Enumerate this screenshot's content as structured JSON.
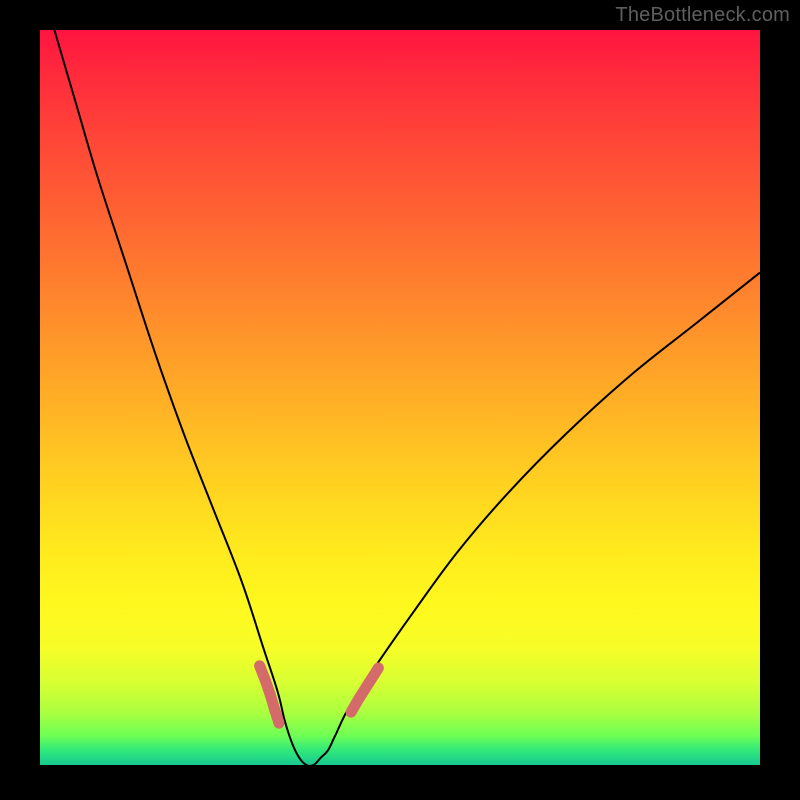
{
  "watermark": "TheBottleneck.com",
  "palette": {
    "gradient_top": "#ff1440",
    "gradient_mid": "#ffe81e",
    "gradient_bottom": "#18c990",
    "curve_stroke": "#000000",
    "marker_fill": "#d46a6a",
    "background": "#000000"
  },
  "chart_data": {
    "type": "line",
    "title": "",
    "xlabel": "",
    "ylabel": "",
    "xlim": [
      0,
      100
    ],
    "ylim": [
      0,
      100
    ],
    "grid": false,
    "legend": false,
    "notes": "V-shaped bottleneck curve; y represents bottleneck severity (0 = balanced/green, 100 = max/red). Minimum is around x≈37.",
    "x": [
      2,
      5,
      8,
      12,
      16,
      20,
      24,
      28,
      31,
      33,
      34,
      35,
      36,
      37,
      38,
      39,
      40,
      41,
      43,
      47,
      52,
      58,
      65,
      73,
      82,
      91,
      100
    ],
    "y": [
      100,
      90,
      80,
      68,
      56,
      45,
      35,
      25,
      16,
      10,
      6,
      3,
      1,
      0,
      0,
      1,
      2,
      4,
      8,
      14,
      21,
      29,
      37,
      45,
      53,
      60,
      67
    ],
    "markers": {
      "comment": "Pink rounded-cap markers near the valley on left and right branches",
      "left_branch": {
        "x": [
          30.5,
          31.3,
          32.0,
          32.6,
          33.2
        ],
        "y": [
          13.5,
          11.5,
          9.5,
          7.5,
          5.7
        ]
      },
      "right_branch": {
        "x": [
          43.2,
          44.4,
          45.7,
          47.0
        ],
        "y": [
          7.2,
          9.2,
          11.2,
          13.2
        ]
      }
    }
  }
}
